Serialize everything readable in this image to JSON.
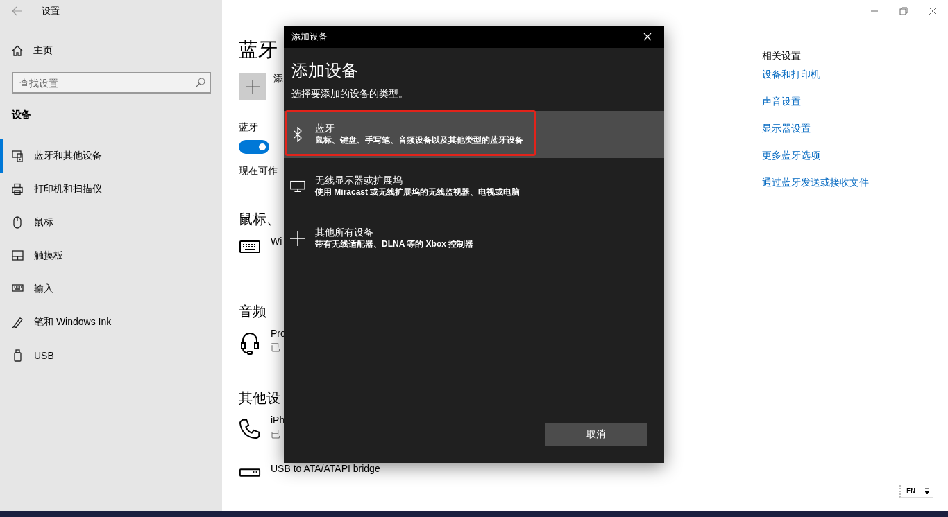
{
  "window": {
    "title": "设置"
  },
  "sidebar": {
    "home": "主页",
    "search": {
      "placeholder": "查找设置"
    },
    "section": "设备",
    "items": [
      {
        "label": "蓝牙和其他设备",
        "selected": true
      },
      {
        "label": "打印机和扫描仪",
        "selected": false
      },
      {
        "label": "鼠标",
        "selected": false
      },
      {
        "label": "触摸板",
        "selected": false
      },
      {
        "label": "输入",
        "selected": false
      },
      {
        "label": "笔和 Windows Ink",
        "selected": false
      },
      {
        "label": "USB",
        "selected": false
      }
    ]
  },
  "main": {
    "title": "蓝牙",
    "add_label": "添",
    "bluetooth": {
      "label": "蓝牙",
      "toggle": {
        "on": true
      }
    },
    "discoverable_text": "现在可作",
    "sections": [
      {
        "heading": "鼠标、",
        "devices": [
          {
            "name": "Wi"
          }
        ]
      },
      {
        "heading": "音频",
        "devices": [
          {
            "name": "Pro",
            "status": "已"
          }
        ]
      },
      {
        "heading": "其他设",
        "devices": [
          {
            "name": "iPh",
            "status": "已"
          },
          {
            "name": "USB to ATA/ATAPI bridge"
          }
        ]
      }
    ]
  },
  "related": {
    "heading": "相关设置",
    "links": [
      "设备和打印机",
      "声音设置",
      "显示器设置",
      "更多蓝牙选项",
      "通过蓝牙发送或接收文件"
    ]
  },
  "dialog": {
    "title": "添加设备",
    "heading": "添加设备",
    "subtitle": "选择要添加的设备的类型。",
    "options": [
      {
        "title": "蓝牙",
        "description": "鼠标、键盘、手写笔、音频设备以及其他类型的蓝牙设备",
        "selected": true,
        "highlighted": true
      },
      {
        "title": "无线显示器或扩展坞",
        "description": "使用 Miracast 或无线扩展坞的无线监视器、电视或电脑",
        "selected": false,
        "highlighted": false
      },
      {
        "title": "其他所有设备",
        "description": "带有无线适配器、DLNA 等的 Xbox 控制器",
        "selected": false,
        "highlighted": false
      }
    ],
    "cancel": "取消"
  },
  "input_indicator": {
    "language": "EN"
  }
}
